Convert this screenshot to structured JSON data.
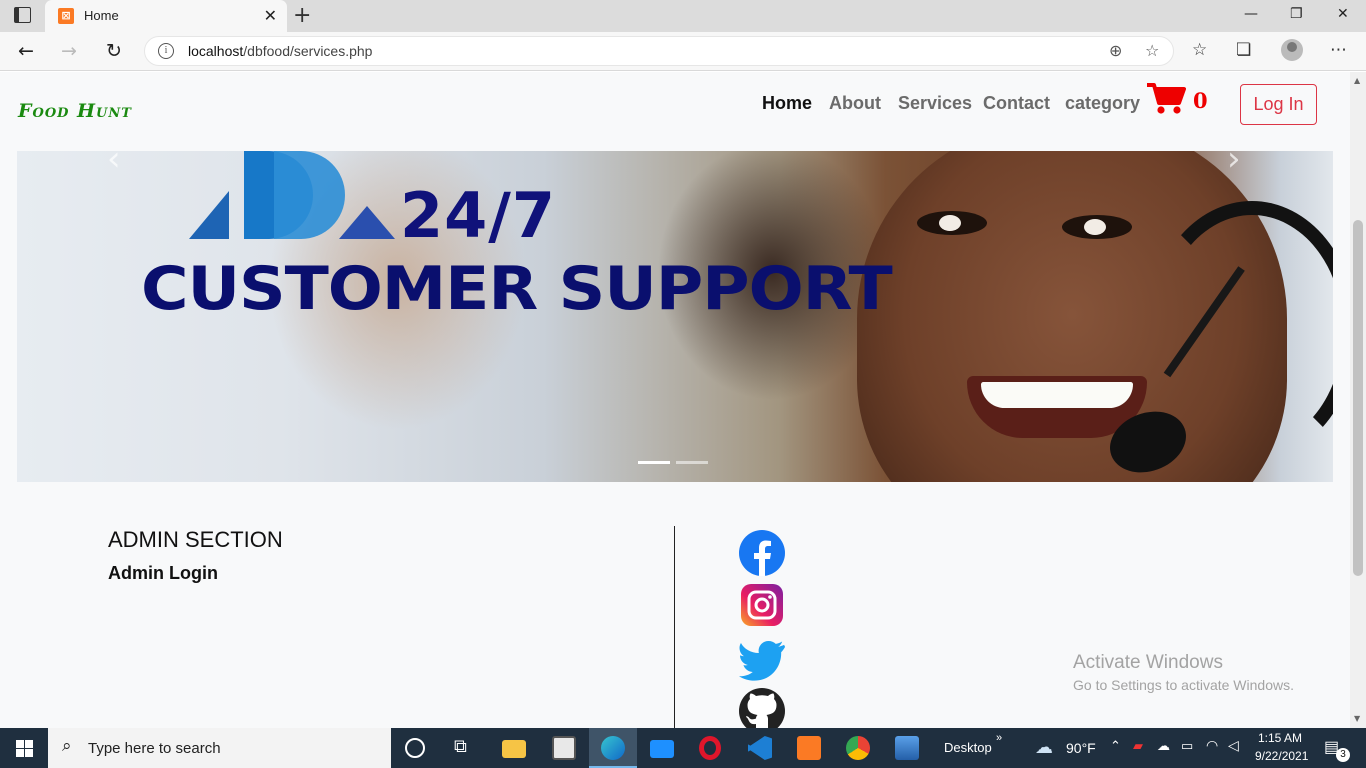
{
  "browser": {
    "tab_title": "Home",
    "tab_favicon": "xampp-icon",
    "url_host": "localhost",
    "url_path": "/dbfood/services.php"
  },
  "navbar": {
    "brand": "Food Hunt",
    "links": [
      "Home",
      "About",
      "Services",
      "Contact",
      "category"
    ],
    "active_link": "Home",
    "cart_count": "0",
    "login_label": "Log In"
  },
  "carousel": {
    "line1": "24/7",
    "line2": "CUSTOMER SUPPORT",
    "slides": 2,
    "active_slide": 1
  },
  "admin": {
    "heading": "ADMIN SECTION",
    "login_link": "Admin Login"
  },
  "social": [
    "facebook-icon",
    "instagram-icon",
    "twitter-icon",
    "github-icon"
  ],
  "watermark": {
    "line1": "Activate Windows",
    "line2": "Go to Settings to activate Windows."
  },
  "taskbar": {
    "search_placeholder": "Type here to search",
    "desktop_label": "Desktop",
    "weather": "90°F",
    "time": "1:15 AM",
    "date": "9/22/2021",
    "notification_count": "3"
  },
  "colors": {
    "brand": "#1a8a10",
    "cart": "#e00000",
    "login": "#dc3545",
    "headline": "#10127a"
  }
}
